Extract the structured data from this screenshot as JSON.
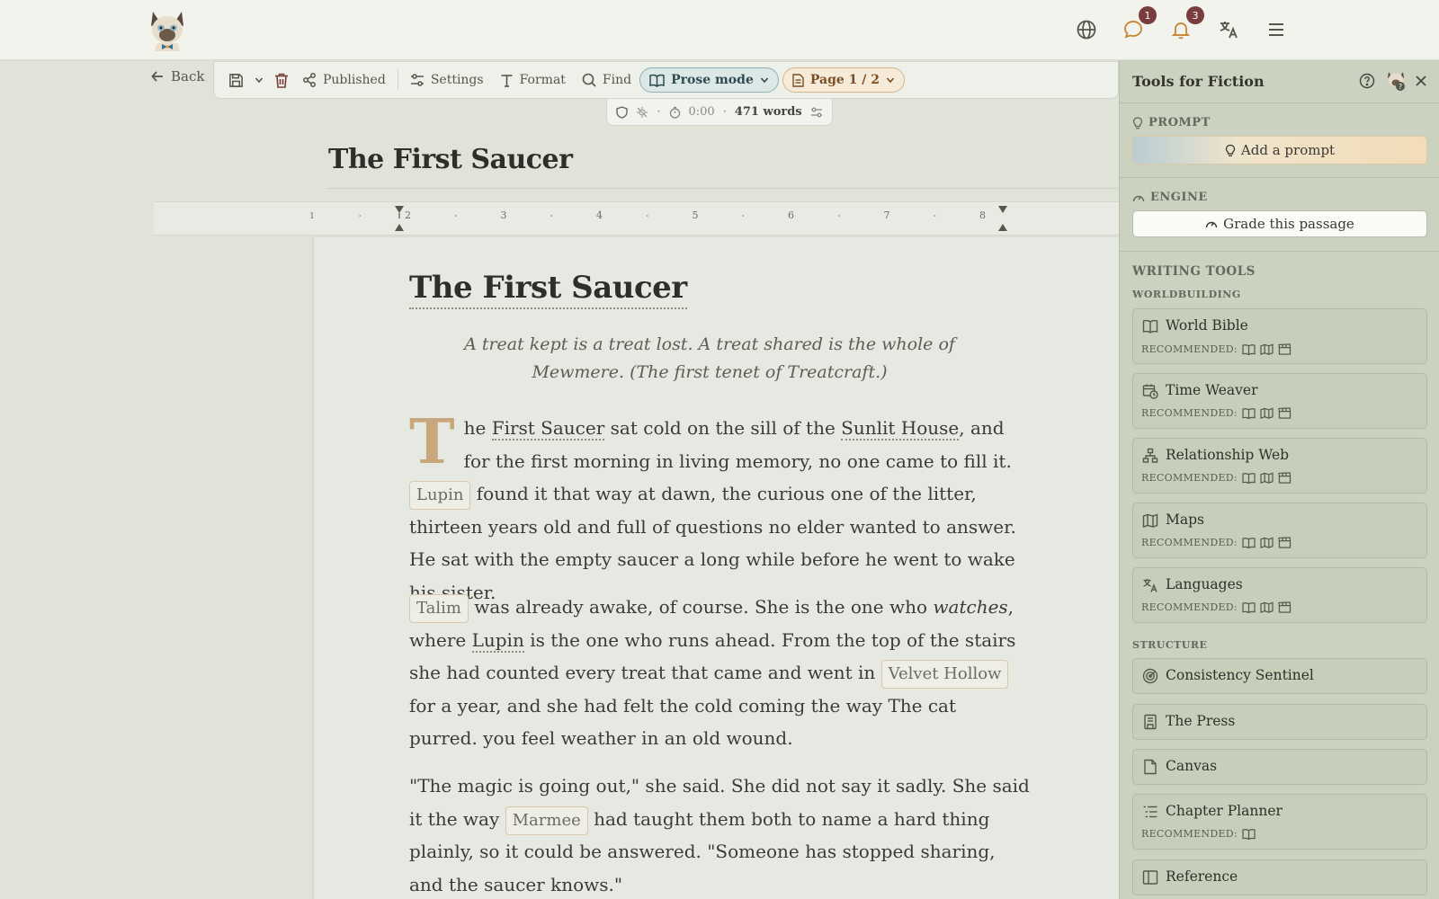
{
  "nav": {
    "badges": {
      "messages": "1",
      "notifications": "3"
    }
  },
  "toolbar": {
    "back": "Back",
    "published": "Published",
    "settings": "Settings",
    "format": "Format",
    "find": "Find",
    "prose_mode": "Prose mode",
    "page": "Page 1 / 2"
  },
  "status": {
    "timer": "0:00",
    "words": "471 words"
  },
  "document": {
    "title": "The First Saucer",
    "page_title": "The First Saucer",
    "epigraph": "A treat kept is a treat lost. A treat shared is the whole of Mewmere. (The first tenet of Treatcraft.)",
    "p1": {
      "dropcap": "T",
      "t1": "he ",
      "e1": "First Saucer",
      "t2": " sat cold on the sill of the ",
      "e2": "Sunlit House",
      "t3": ", and for the first morning in living memory, no one came to fill it. ",
      "chip1": "Lupin",
      "t4": " found it that way at dawn, the curious one of the litter, thirteen years old and full of questions no elder wanted to answer. He sat with the empty saucer a long while before he went to wake his sister."
    },
    "p2": {
      "chip1": "Talim",
      "t1": " was already awake, of course. She is the one who ",
      "em": "watches",
      "t2": ", where ",
      "e1": "Lupin",
      "t3": " is the one who runs ahead. From the top of the stairs she had counted every treat that came and went in ",
      "chip2": "Velvet Hollow",
      "t4": " for a year, and she had felt the cold coming the way The cat purred. you feel weather in an old wound."
    },
    "p3": {
      "t1": "\"The magic is going out,\" she said. She did not say it sadly. She said it the way ",
      "chip1": "Marmee",
      "t2": " had taught them both to name a hard thing plainly, so it could be answered. \"Someone has stopped sharing, and the saucer knows.\""
    }
  },
  "ruler": {
    "numbers": [
      "1",
      "2",
      "3",
      "4",
      "5",
      "6",
      "7",
      "8"
    ]
  },
  "panel": {
    "title": "Tools for Fiction",
    "prompt_label": "PROMPT",
    "add_prompt": "Add a prompt",
    "engine_label": "ENGINE",
    "grade": "Grade this passage",
    "writing_tools": "WRITING TOOLS",
    "worldbuilding": "WORLDBUILDING",
    "structure": "STRUCTURE",
    "recommended": "RECOMMENDED:",
    "tools": {
      "world_bible": "World Bible",
      "time_weaver": "Time Weaver",
      "relationship_web": "Relationship Web",
      "maps": "Maps",
      "languages": "Languages",
      "consistency_sentinel": "Consistency Sentinel",
      "the_press": "The Press",
      "canvas": "Canvas",
      "chapter_planner": "Chapter Planner",
      "reference": "Reference"
    }
  }
}
